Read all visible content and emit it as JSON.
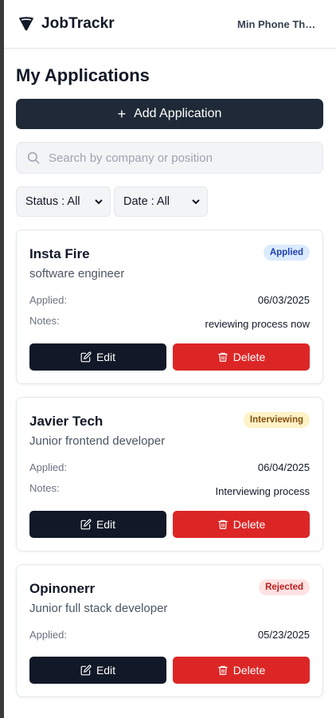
{
  "header": {
    "brand": "JobTrackr",
    "user": "Min Phone Thant"
  },
  "page": {
    "title": "My Applications",
    "add_label": "Add Application",
    "search_placeholder": "Search by company or position"
  },
  "filters": {
    "status": "Status : All",
    "date": "Date : All"
  },
  "labels": {
    "applied": "Applied:",
    "notes": "Notes:",
    "edit": "Edit",
    "delete": "Delete"
  },
  "applications": [
    {
      "company": "Insta Fire",
      "position": "software engineer",
      "status": "Applied",
      "applied_date": "06/03/2025",
      "notes": "reviewing process now"
    },
    {
      "company": "Javier Tech",
      "position": "Junior frontend developer",
      "status": "Interviewing",
      "applied_date": "06/04/2025",
      "notes": "Interviewing process"
    },
    {
      "company": "Opinonerr",
      "position": "Junior full stack developer",
      "status": "Rejected",
      "applied_date": "05/23/2025",
      "notes": ""
    }
  ],
  "colors": {
    "primary": "#1f2937",
    "danger": "#dc2626",
    "applied_badge": "#dbeafe",
    "interviewing_badge": "#fef3c7",
    "rejected_badge": "#fee2e2"
  },
  "icons": {
    "brand": "funnel-icon",
    "search": "search-icon",
    "add": "plus-icon",
    "edit": "edit-icon",
    "delete": "trash-icon",
    "dropdown": "chevron-down-icon"
  }
}
